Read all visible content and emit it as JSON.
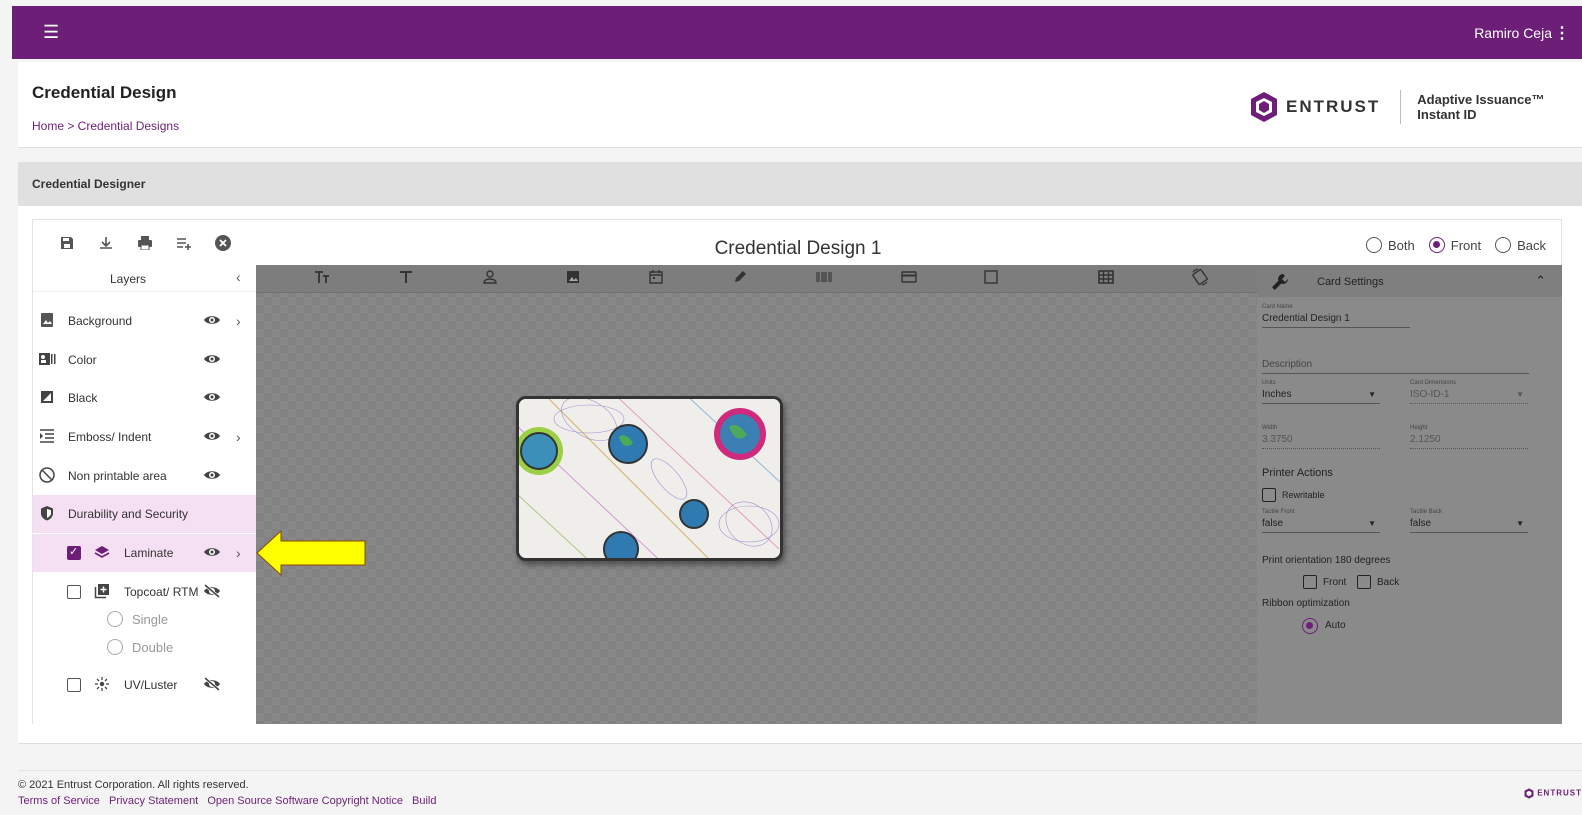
{
  "appbar": {
    "user": "Ramiro Ceja",
    "menu_icon": "☰",
    "kebab_icon": "⋮"
  },
  "header": {
    "title": "Credential Design",
    "breadcrumb": "Home > Credential Designs",
    "brand_name": "ENTRUST",
    "product_line1": "Adaptive Issuance™",
    "product_line2": "Instant ID"
  },
  "section": {
    "title": "Credential Designer"
  },
  "designer": {
    "design_title": "Credential Design 1",
    "sides": {
      "both": "Both",
      "front": "Front",
      "back": "Back",
      "selected": "front"
    }
  },
  "layers": {
    "title": "Layers",
    "items": [
      {
        "label": "Background"
      },
      {
        "label": "Color"
      },
      {
        "label": "Black"
      },
      {
        "label": "Emboss/ Indent"
      },
      {
        "label": "Non printable area"
      },
      {
        "label": "Durability and Security"
      },
      {
        "label": "Laminate",
        "checked": true
      },
      {
        "label": "Topcoat/ RTM",
        "checked": false
      },
      {
        "label": "UV/Luster",
        "checked": false
      }
    ],
    "topcoat_options": [
      "Single",
      "Double"
    ]
  },
  "card_settings": {
    "title": "Card Settings",
    "card_name_label": "Card Name",
    "card_name": "Credential Design 1",
    "description_placeholder": "Description",
    "units_label": "Units",
    "units": "Inches",
    "dimensions_label": "Card Dimensions",
    "dimensions": "ISO-ID-1",
    "width_label": "Width",
    "width": "3.3750",
    "height_label": "Height",
    "height": "2.1250",
    "printer_actions": "Printer Actions",
    "rewritable": "Rewritable",
    "tactile_front_label": "Tactile Front",
    "tactile_front": "false",
    "tactile_back_label": "Tactile Back",
    "tactile_back": "false",
    "print_orientation": "Print orientation 180 degrees",
    "orient_front": "Front",
    "orient_back": "Back",
    "ribbon_optimization": "Ribbon optimization",
    "ribbon_auto": "Auto"
  },
  "footer": {
    "copyright": "© 2021 Entrust Corporation. All rights reserved.",
    "links": [
      "Terms of Service",
      "Privacy Statement",
      "Open Source Software Copyright Notice",
      "Build"
    ],
    "logo_text": "ENTRUST"
  },
  "colors": {
    "brand": "#6d1f78",
    "highlight_row": "#f5dff2",
    "arrow": "#ffff00"
  }
}
